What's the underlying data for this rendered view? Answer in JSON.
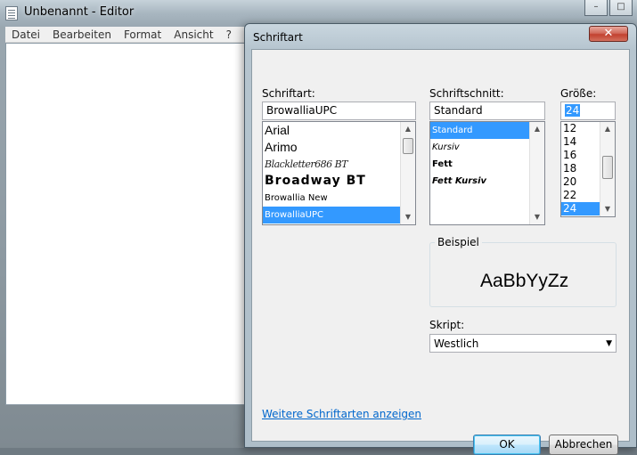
{
  "editor": {
    "title": "Unbenannt - Editor",
    "menu": [
      "Datei",
      "Bearbeiten",
      "Format",
      "Ansicht",
      "?"
    ],
    "minimize_label": "–",
    "maximize_label": "□"
  },
  "dialog": {
    "title": "Schriftart",
    "close_label": "✕",
    "font": {
      "label": "Schriftart:",
      "value": "BrowalliaUPC",
      "items": [
        "Arial",
        "Arimo",
        "Blackletter686 BT",
        "Broadway BT",
        "Browallia New",
        "BrowalliaUPC"
      ],
      "selected": "BrowalliaUPC"
    },
    "style": {
      "label": "Schriftschnitt:",
      "value": "Standard",
      "items": [
        "Standard",
        "Kursiv",
        "Fett",
        "Fett Kursiv"
      ],
      "selected": "Standard"
    },
    "size": {
      "label": "Größe:",
      "value": "24",
      "items": [
        "12",
        "14",
        "16",
        "18",
        "20",
        "22",
        "24"
      ],
      "selected": "24"
    },
    "sample": {
      "label": "Beispiel",
      "text": "AaBbYyZz"
    },
    "script": {
      "label": "Skript:",
      "value": "Westlich"
    },
    "more_fonts_link": "Weitere Schriftarten anzeigen",
    "ok_label": "OK",
    "cancel_label": "Abbrechen"
  }
}
